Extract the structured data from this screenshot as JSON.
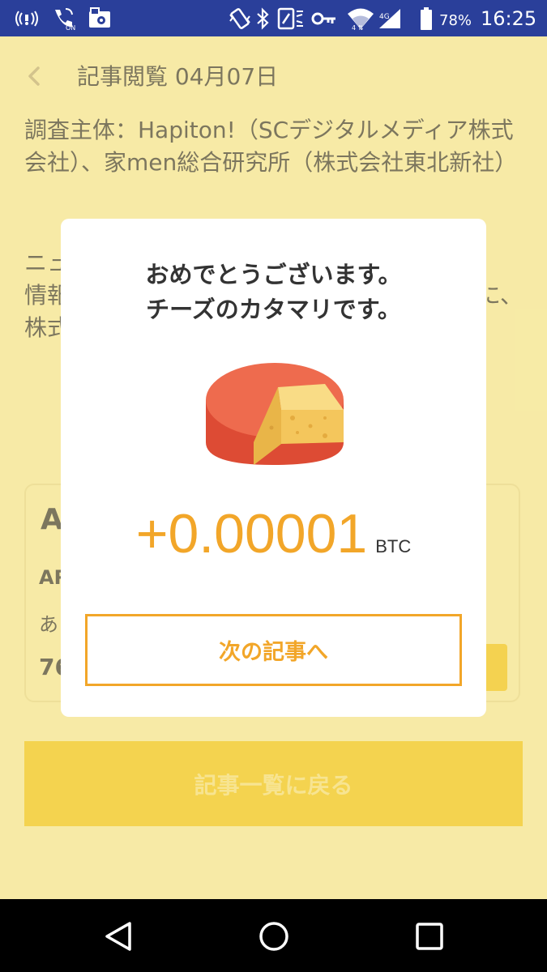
{
  "status_bar": {
    "battery_percent": "78%",
    "time": "16:25",
    "icons": [
      "signal-broadcast-icon",
      "wifi-calling-on-icon",
      "notification-card-icon",
      "vibrate-icon",
      "bluetooth-icon",
      "nfc-icon",
      "vpn-key-icon",
      "wifi-icon",
      "cellular-signal-icon",
      "battery-icon"
    ]
  },
  "header": {
    "back_icon": "chevron-left-icon",
    "title": "記事閲覧 04月07日"
  },
  "article": {
    "paragraph1": "調査主体：Hapiton!（SCデジタルメディア株式会社）、家men総合研究所（株式会社東北新社）",
    "paragraph2_visible_start": "ニュ",
    "paragraph2_line2_start": "情報",
    "paragraph2_line2_end": "に、",
    "paragraph2_line3_start": "株式"
  },
  "card": {
    "heading": "A",
    "subheading": "AR",
    "text": "あ",
    "amount": "76"
  },
  "back_to_list_label": "記事一覧に戻る",
  "modal": {
    "message_line1": "おめでとうございます。",
    "message_line2": "チーズのカタマリです。",
    "reward_amount": "+0.00001",
    "reward_unit": "BTC",
    "next_button_label": "次の記事へ",
    "image": "cheese-wheel-icon"
  },
  "nav_bar": {
    "icons": [
      "back-triangle-icon",
      "home-circle-icon",
      "recents-square-icon"
    ]
  },
  "colors": {
    "status_bar": "#2a3f9a",
    "page_background": "#f5e79a",
    "accent_orange": "#f2a629",
    "button_yellow": "#f2ca2e",
    "text_dark": "#5c5640"
  }
}
